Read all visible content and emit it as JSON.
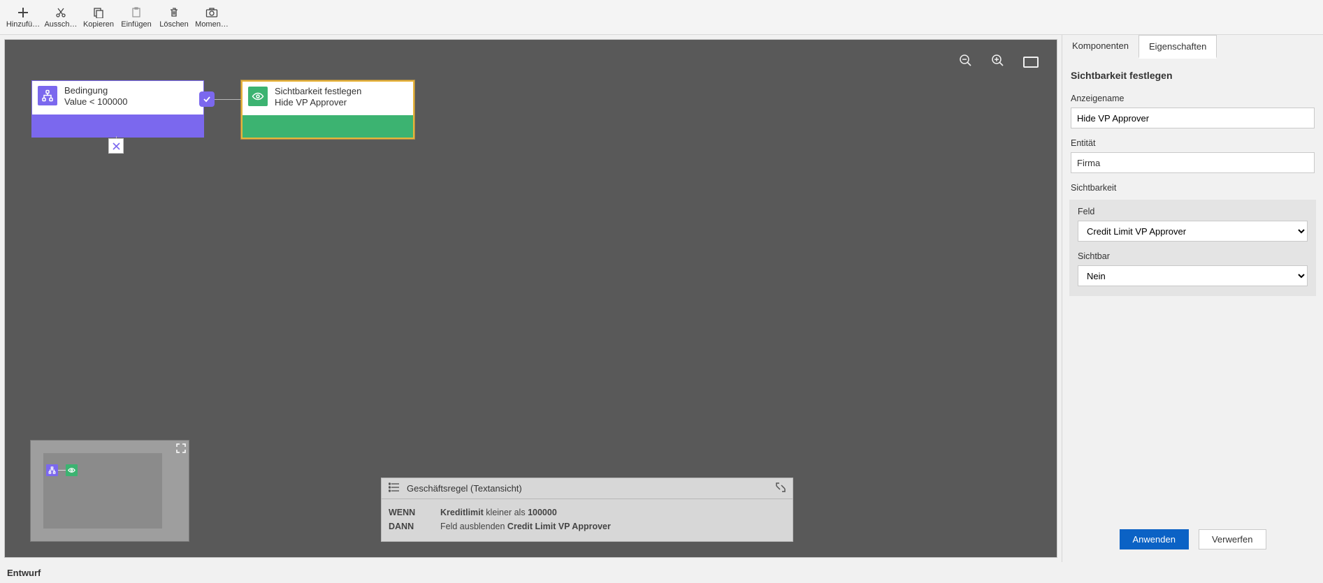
{
  "toolbar": {
    "add": "Hinzufü…",
    "cut": "Aussch…",
    "copy": "Kopieren",
    "paste": "Einfügen",
    "delete": "Löschen",
    "snap": "Momen…"
  },
  "nodes": {
    "condition": {
      "title": "Bedingung",
      "subtitle": "Value < 100000"
    },
    "action": {
      "title": "Sichtbarkeit festlegen",
      "subtitle": "Hide VP Approver"
    }
  },
  "textview": {
    "title": "Geschäftsregel (Textansicht)",
    "when_label": "WENN",
    "then_label": "DANN",
    "when_field": "Kreditlimit",
    "when_op": "kleiner als",
    "when_value": "100000",
    "then_prefix": "Feld ausblenden",
    "then_field": "Credit Limit VP Approver"
  },
  "side": {
    "tab_components": "Komponenten",
    "tab_properties": "Eigenschaften",
    "heading": "Sichtbarkeit festlegen",
    "lbl_displayname": "Anzeigename",
    "val_displayname": "Hide VP Approver",
    "lbl_entity": "Entität",
    "val_entity": "Firma",
    "section_visibility": "Sichtbarkeit",
    "lbl_field": "Feld",
    "val_field": "Credit Limit VP Approver",
    "lbl_visible": "Sichtbar",
    "val_visible": "Nein",
    "btn_apply": "Anwenden",
    "btn_discard": "Verwerfen"
  },
  "status": {
    "text": "Entwurf"
  }
}
